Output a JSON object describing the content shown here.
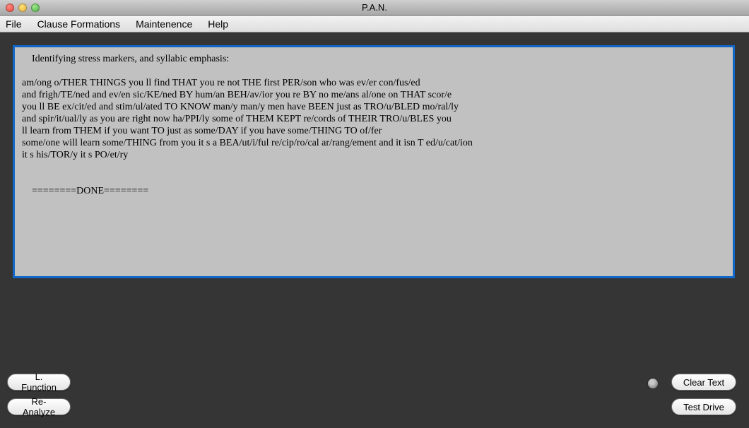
{
  "window": {
    "title": "P.A.N."
  },
  "menubar": {
    "items": [
      "File",
      "Clause Formations",
      "Maintenence",
      "Help"
    ]
  },
  "text": {
    "header": "Identifying stress markers, and syllabic emphasis:",
    "lines": [
      "am/ong o/THER THINGS you ll find THAT you re not THE first PER/son who was ev/er con/fus/ed",
      "and frigh/TE/ned and ev/en sic/KE/ned BY hum/an BEH/av/ior you re BY no me/ans al/one on THAT scor/e",
      "you ll BE ex/cit/ed and stim/ul/ated TO KNOW man/y man/y men have BEEN just as TRO/u/BLED mo/ral/ly",
      "and spir/it/ual/ly as you are right now ha/PPI/ly some of THEM KEPT re/cords of THEIR TRO/u/BLES you",
      "ll learn from THEM if you want TO just as some/DAY if you have some/THING TO of/fer",
      "some/one will learn some/THING from you it s a BEA/ut/i/ful re/cip/ro/cal ar/rang/ement and it isn T ed/u/cat/ion",
      "it s his/TOR/y it s PO/et/ry"
    ],
    "done": "========DONE========"
  },
  "buttons": {
    "l_function": "L. Function",
    "re_analyze": "Re-Analyze",
    "clear_text": "Clear Text",
    "test_drive": "Test Drive"
  }
}
